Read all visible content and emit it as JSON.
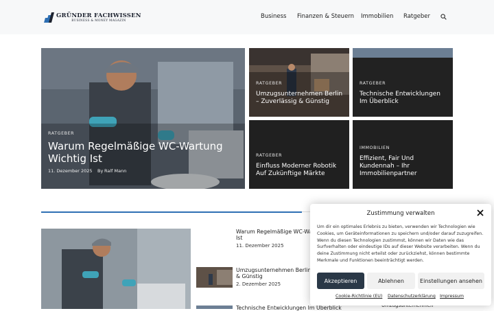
{
  "header": {
    "logo_title": "GRÜNDER FACHWISSEN",
    "logo_sub": "BUSINESS & MONEY MAGAZIN",
    "nav": [
      "Business",
      "Finanzen & Steuern",
      "Immobilien",
      "Ratgeber"
    ],
    "search_icon": "search-icon"
  },
  "hero": {
    "main": {
      "category": "RATGEBER",
      "title_line1": "Warum Regelmäßige WC-Wartung",
      "title_line2": "Wichtig Ist",
      "date": "11. Dezember 2025",
      "by": "By",
      "author": "Ralf Mann"
    },
    "tiles": [
      {
        "category": "RATGEBER",
        "line1": "Umzugsunternehmen Berlin",
        "line2": "– Zuverlässig & Günstig"
      },
      {
        "category": "RATGEBER",
        "line1": "Technische Entwicklungen",
        "line2": "Im Überblick"
      },
      {
        "category": "RATGEBER",
        "line1": "Einfluss Moderner Robotik",
        "line2": "Auf Zukünftige Märkte"
      },
      {
        "category": "IMMOBILIEN",
        "line1": "Effizient, Fair Und",
        "line2": "Kundennah – Ihr",
        "line3": "Immobilienpartner"
      }
    ]
  },
  "list": [
    {
      "title_line1": "Warum Regelmäßige WC-Wartung",
      "title_line2": "Ist",
      "date": "11. Dezember 2025"
    },
    {
      "title_line1": "Umzugsunternehmen Berlin –",
      "title_line2": "& Günstig",
      "date": "2. Dezember 2025"
    },
    {
      "title_line1": "Technische Entwicklungen Im Überblick",
      "title_line2": "",
      "date": ""
    }
  ],
  "sidebar_peek": "Umzugsunternehmen",
  "cookie": {
    "title": "Zustimmung verwalten",
    "text": "Um dir ein optimales Erlebnis zu bieten, verwenden wir Technologien wie Cookies, um Geräteinformationen zu speichern und/oder darauf zuzugreifen. Wenn du diesen Technologien zustimmst, können wir Daten wie das Surfverhalten oder eindeutige IDs auf dieser Website verarbeiten. Wenn du deine Zustimmung nicht erteilst oder zurückziehst, können bestimmte Merkmale und Funktionen beeinträchtigt werden.",
    "accept": "Akzeptieren",
    "reject": "Ablehnen",
    "settings": "Einstellungen ansehen",
    "link1": "Cookie-Richtlinie (EU)",
    "link2": "Datenschutzerklärung",
    "link3": "Impressum"
  },
  "colors": {
    "accent": "#2d6fb3",
    "dark_tile": "#202020",
    "accept_button": "#2a3847"
  }
}
